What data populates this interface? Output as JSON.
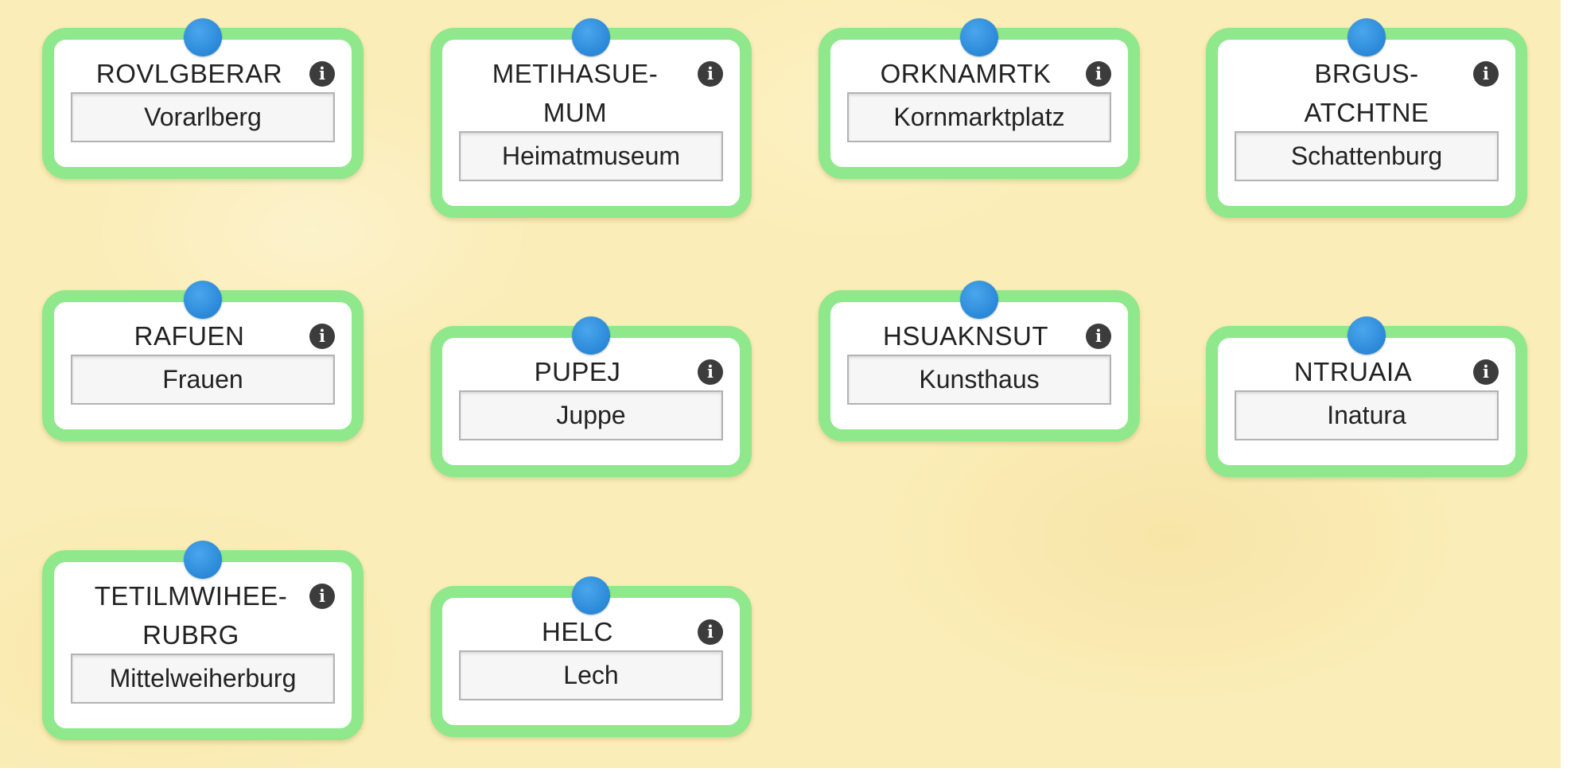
{
  "cards": [
    {
      "scrambled": "ROVLGBERAR",
      "answer": "Vorarlberg"
    },
    {
      "scrambled": "METIHASUE-MUM",
      "answer": "Heimatmuseum"
    },
    {
      "scrambled": "ORKNAMRTK",
      "answer": "Kornmarktplatz"
    },
    {
      "scrambled": "BRGUS-ATCHTNE",
      "answer": "Schattenburg"
    },
    {
      "scrambled": "RAFUEN",
      "answer": "Frauen"
    },
    {
      "scrambled": "PUPEJ",
      "answer": "Juppe"
    },
    {
      "scrambled": "HSUAKNSUT",
      "answer": "Kunsthaus"
    },
    {
      "scrambled": "NTRUAIA",
      "answer": "Inatura"
    },
    {
      "scrambled": "TETILMWIHEE-RUBRG",
      "answer": "Mittelweiherburg"
    },
    {
      "scrambled": "HELC",
      "answer": "Lech"
    }
  ],
  "icons": {
    "info": "info-circle-icon",
    "pin": "pushpin-icon"
  },
  "info_glyph": "i",
  "colors": {
    "board": "#fbedb7",
    "card_border": "#8fe88c",
    "pin": "#2a88d8",
    "info_icon": "#3c3c3c"
  }
}
